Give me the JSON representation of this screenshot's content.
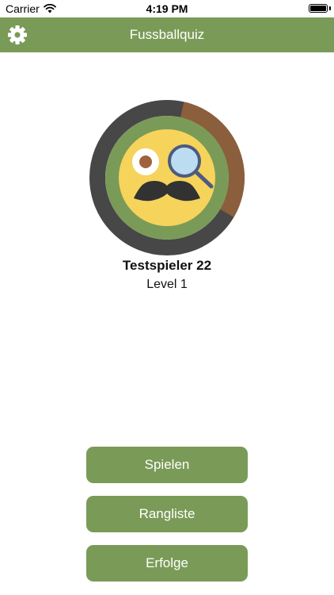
{
  "status_bar": {
    "carrier": "Carrier",
    "time": "4:19 PM"
  },
  "nav": {
    "title": "Fussballquiz",
    "settings_icon": "gear-icon"
  },
  "profile": {
    "name": "Testspieler 22",
    "level": "Level 1",
    "level_progress": 0.3,
    "avatar_icon": "monocle-mustache-emoji"
  },
  "menu": {
    "play_label": "Spielen",
    "ranking_label": "Rangliste",
    "achievements_label": "Erfolge"
  },
  "colors": {
    "accent": "#7a9b57",
    "progress": "#8b5e3c",
    "ring_track": "#474747",
    "face": "#f6d35b"
  }
}
